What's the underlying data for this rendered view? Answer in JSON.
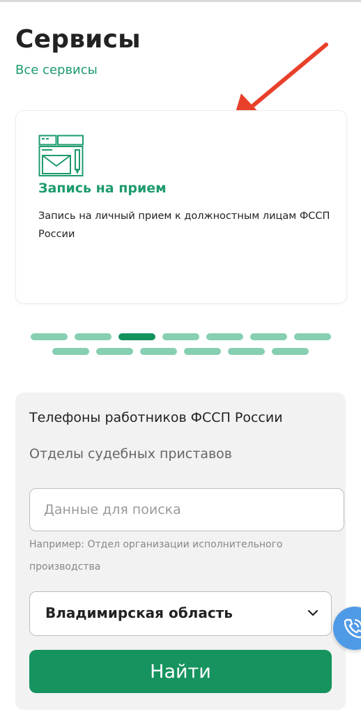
{
  "header": {
    "title": "Сервисы",
    "all_services_link": "Все сервисы"
  },
  "service_card": {
    "icon": "appointment-icon",
    "title": "Запись на прием",
    "description": "Запись на личный прием к должностным лицам ФССП России"
  },
  "carousel": {
    "row1_count": 7,
    "row2_count": 6,
    "active_index": 2
  },
  "phones_panel": {
    "title": "Телефоны работников ФССП России",
    "subtitle": "Отделы судебных приставов",
    "search_placeholder": "Данные для поиска",
    "hint": "Например: Отдел организации исполнительного производства",
    "region_selected": "Владимирская область",
    "find_label": "Найти"
  },
  "floating": {
    "call_icon": "phone-call-icon"
  },
  "colors": {
    "accent_green": "#1d9b6c",
    "button_green": "#16935f",
    "dot_inactive": "#86cfb1",
    "dot_active": "#14925e",
    "arrow_red": "#e8402a",
    "fab_blue": "#4f9ae6"
  }
}
